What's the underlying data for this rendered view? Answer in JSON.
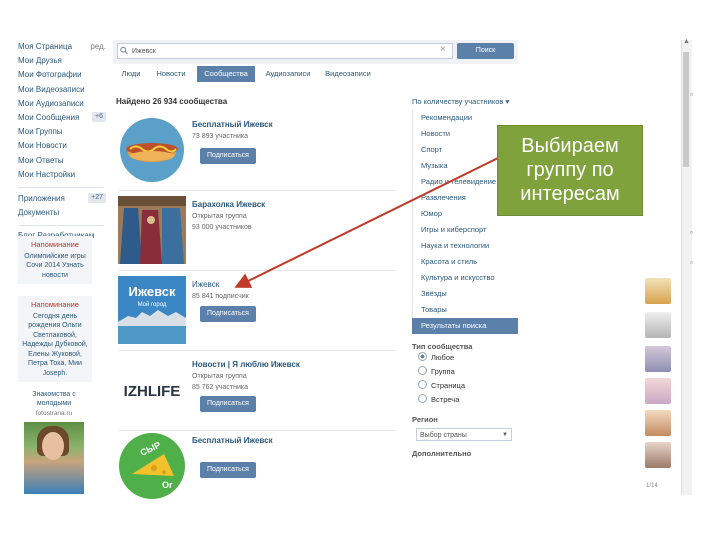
{
  "sidebar": {
    "items": [
      {
        "label": "Моя Страница",
        "extra": "ред."
      },
      {
        "label": "Мои Друзья"
      },
      {
        "label": "Мои Фотографии"
      },
      {
        "label": "Мои Видеозаписи"
      },
      {
        "label": "Мои Аудиозаписи"
      },
      {
        "label": "Мои Сообщения",
        "badge": "+6"
      },
      {
        "label": "Мои Группы"
      },
      {
        "label": "Мои Новости"
      },
      {
        "label": "Мои Ответы"
      },
      {
        "label": "Мои Настройки"
      }
    ],
    "apps": [
      {
        "label": "Приложения",
        "badge": "+27"
      },
      {
        "label": "Документы"
      }
    ],
    "links": "Блог  Разработчикам"
  },
  "reminders": [
    {
      "title": "Напоминание",
      "text": "Олимпийские игры Сочи 2014 Узнать новости"
    },
    {
      "title": "Напоминание",
      "text": "Сегодня день рождения Ольги Светлаковой, Надежды Дубковой, Елены Жуковой, Петра Тока, Мии Joseph."
    }
  ],
  "ad": {
    "title": "Знакомства с молодыми",
    "subtitle": "fotostrana.ru"
  },
  "search": {
    "value": "Ижевск",
    "clear_icon": "×",
    "button": "Поиск"
  },
  "tabs": [
    "Люди",
    "Новости",
    "Сообщества",
    "Аудиозаписи",
    "Видеозаписи"
  ],
  "results": {
    "found": "Найдено 26 934 сообщества",
    "sort": "По количеству участников ▾",
    "groups": [
      {
        "name": "Бесплатный Ижевск",
        "type": "Открытая группа",
        "count": "73 893 участника",
        "join": "Подписаться",
        "avatar": "hotdog"
      },
      {
        "name": "Барахолка Ижевск",
        "type": "Открытая группа",
        "count": "93 000 участников",
        "join": "",
        "avatar": "clothes"
      },
      {
        "name": "Ижевск",
        "type": "",
        "count": "85 841 подписчик",
        "join": "Подписаться",
        "avatar": "city"
      },
      {
        "name": "Новости | Я люблю Ижевск",
        "type": "Открытая группа",
        "count": "85 762 участника",
        "join": "Подписаться",
        "avatar": "izhlife"
      },
      {
        "name": "Бесплатный Ижевск",
        "type": "",
        "count": "",
        "join": "Подписаться",
        "avatar": "cheese"
      }
    ],
    "avatar_text": {
      "city": "Ижевск",
      "city_sub": "Мой город",
      "izhlife": "IZHLIFE",
      "cheese": "СЫР",
      "cheese_sub": "Оr"
    }
  },
  "filters": {
    "categories": [
      "Рекомендации",
      "Новости",
      "Спорт",
      "Музыка",
      "Радио и телевидение",
      "Развлечения",
      "Юмор",
      "Игры и киберспорт",
      "Наука и технологии",
      "Красота и стиль",
      "Культура и искусство",
      "Звёзды",
      "Товары",
      "Результаты поиска"
    ],
    "selected": "Результаты поиска",
    "type_label": "Тип сообщества",
    "types": [
      "Любое",
      "Группа",
      "Страница",
      "Встреча"
    ],
    "selected_type": "Любое",
    "region_label": "Регион",
    "region_value": "Выбор страны",
    "more_label": "Дополнительно"
  },
  "callout": {
    "text": "Выбираем группу по интересам"
  },
  "page_num": "1/14",
  "colors": {
    "accent": "#5b80aa",
    "link": "#2b587a",
    "callout": "#7fa23c",
    "arrow": "#c0392b"
  }
}
